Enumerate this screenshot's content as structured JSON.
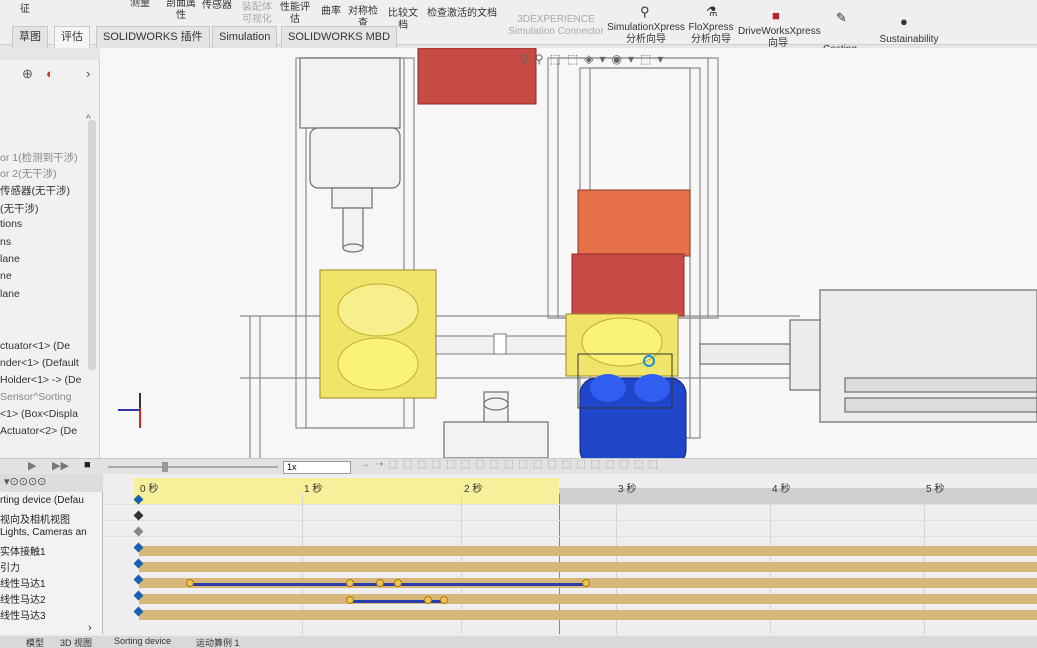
{
  "ribbon": {
    "items": [
      {
        "label": "征",
        "dim": false
      },
      {
        "label": "测量",
        "dim": false
      },
      {
        "label": "剖面属性",
        "dim": false
      },
      {
        "label": "传感器",
        "dim": false
      },
      {
        "label": "装配体可视化",
        "dim": true
      },
      {
        "label": "性能评估",
        "dim": false
      },
      {
        "label": "曲率",
        "dim": false
      },
      {
        "label": "对称检查",
        "dim": false
      },
      {
        "label": "比较文档",
        "dim": false
      },
      {
        "label": "检查激活的文档",
        "dim": false
      },
      {
        "label": "3DEXPERIENCE Simulation Connector",
        "dim": true
      },
      {
        "label": "SimulationXpress 分析向导",
        "dim": false
      },
      {
        "label": "FloXpress 分析向导",
        "dim": false
      },
      {
        "label": "DriveWorksXpress 向导",
        "dim": false
      },
      {
        "label": "Costing",
        "dim": false
      },
      {
        "label": "Sustainability",
        "dim": false
      }
    ]
  },
  "tabs": [
    {
      "label": "草图",
      "active": false
    },
    {
      "label": "评估",
      "active": true
    },
    {
      "label": "SOLIDWORKS 插件",
      "active": false
    },
    {
      "label": "Simulation",
      "active": false
    },
    {
      "label": "SOLIDWORKS MBD",
      "active": false
    }
  ],
  "feature_tree": {
    "rows": [
      {
        "label": "or 1(检测到干涉)",
        "gray": true
      },
      {
        "label": "or 2(无干涉)",
        "gray": true
      },
      {
        "label": "传感器(无干涉)",
        "gray": false
      },
      {
        "label": "(无干涉)",
        "gray": false
      },
      {
        "label": "tions",
        "gray": false
      },
      {
        "label": "ns",
        "gray": false
      },
      {
        "label": "lane",
        "gray": false
      },
      {
        "label": "ne",
        "gray": false
      },
      {
        "label": "lane",
        "gray": false
      },
      {
        "label": "ctuator<1> (De",
        "gray": false
      },
      {
        "label": "nder<1> (Default",
        "gray": false
      },
      {
        "label": "Holder<1> -> (De",
        "gray": false
      },
      {
        "label": "Sensor^Sorting",
        "gray": true
      },
      {
        "label": "<1> (Box<Displa",
        "gray": false
      },
      {
        "label": "Actuator<2> (De",
        "gray": false
      }
    ]
  },
  "motion_toolbar": {
    "speed": "1x"
  },
  "timeline": {
    "ticks": [
      "0 秒",
      "1 秒",
      "2 秒",
      "3 秒",
      "4 秒",
      "5 秒"
    ],
    "rows": [
      "rting device (Defau",
      "视向及相机视图",
      "Lights, Cameras an",
      "实体接触1",
      "引力",
      "线性马达1",
      "线性马达2",
      "线性马达3"
    ]
  },
  "bottom_tabs": [
    "模型",
    "3D 视图",
    "Sorting device",
    "运动算例 1"
  ],
  "colors": {
    "orange_box": "#e5704a",
    "red_box": "#c84a45",
    "yellow_box": "#f1e46b",
    "blue_part": "#1f46c8",
    "timeline_band": "#d8b77a"
  }
}
